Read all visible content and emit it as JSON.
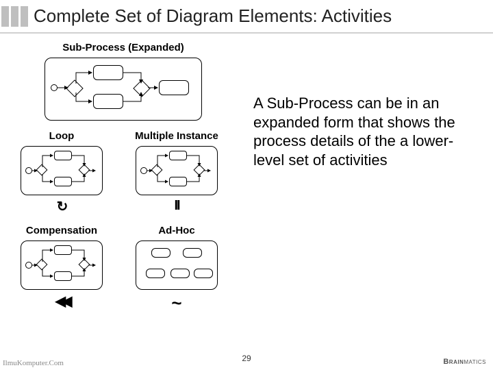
{
  "title": "Complete Set of Diagram Elements: Activities",
  "description": "A Sub-Process can be in an expanded form that shows the process details of the a lower-level set of activities",
  "labels": {
    "subprocess": "Sub-Process (Expanded)",
    "loop": "Loop",
    "multiple_instance": "Multiple Instance",
    "compensation": "Compensation",
    "adhoc": "Ad-Hoc"
  },
  "markers": {
    "loop": "↻",
    "multiple_instance": "II",
    "compensation": "◀◀",
    "adhoc": "~"
  },
  "page_number": "29",
  "footer_left": "IlmuKomputer.Com",
  "footer_right_bold": "Brain",
  "footer_right_rest": "matics"
}
